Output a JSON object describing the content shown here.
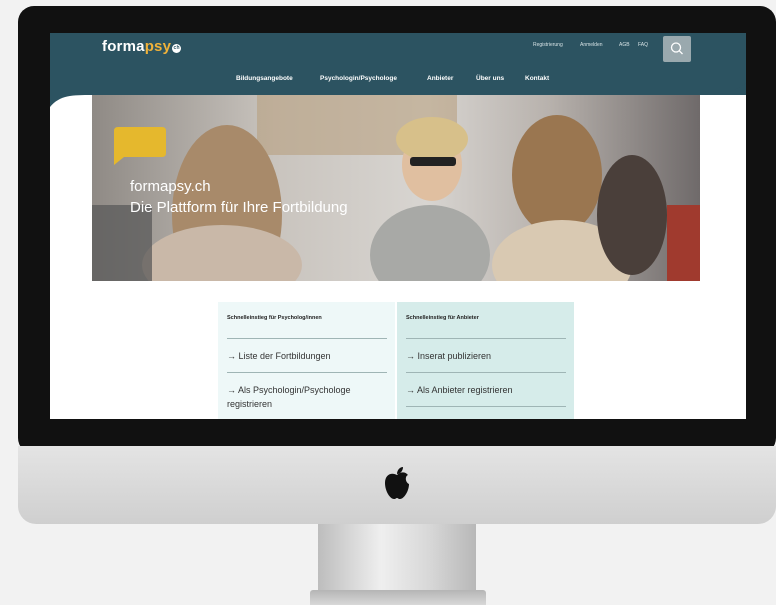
{
  "header": {
    "logo_main": "forma",
    "logo_accent": "psy",
    "logo_badge": "ch",
    "util_links": [
      "Registrierung",
      "Anmelden",
      "AGB",
      "FAQ"
    ],
    "search_icon": "search-icon"
  },
  "nav": [
    "Bildungsangebote",
    "Psychologin/Psychologe",
    "Anbieter",
    "Über uns",
    "Kontakt"
  ],
  "hero": {
    "line1": "formapsy.ch",
    "line2": "Die Plattform für Ihre Fortbildung",
    "bubble_color": "#e5b82d"
  },
  "quick_psych": {
    "title": "Schnelleinstieg für Psycholog/innen",
    "link1": "→ Liste der Fortbildungen",
    "link2": "→ Als Psychologin/Psychologe registrieren"
  },
  "quick_provider": {
    "title": "Schnelleinstieg für Anbieter",
    "link1": "→ Inserat publizieren",
    "link2": "→ Als Anbieter registrieren"
  },
  "colors": {
    "header": "#2c5361",
    "accent": "#f0b23a"
  }
}
